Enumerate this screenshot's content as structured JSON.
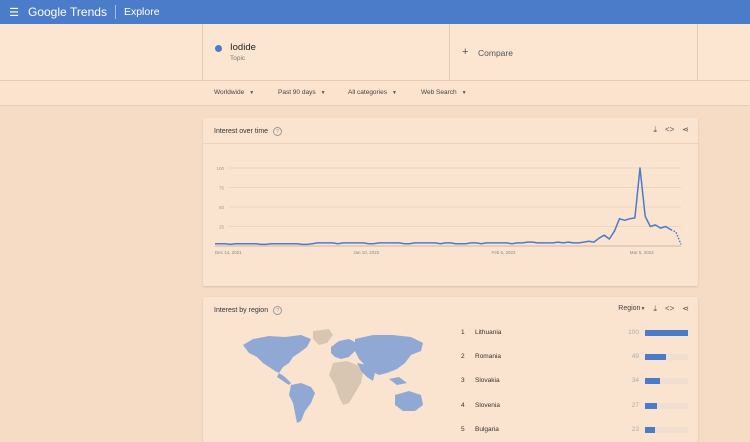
{
  "topbar": {
    "menu_icon": "menu-icon",
    "brand_google": "Google",
    "brand_trends": "Trends",
    "section": "Explore"
  },
  "search": {
    "term": "Iodide",
    "term_type": "Topic",
    "compare_label": "Compare",
    "accent_color": "#4a7cc9"
  },
  "filters": {
    "location": "Worldwide",
    "period": "Past 90 days",
    "category": "All categories",
    "search_type": "Web Search"
  },
  "interest_over_time": {
    "title": "Interest over time",
    "actions": [
      "download-icon",
      "embed-icon",
      "share-icon"
    ]
  },
  "chart_data": {
    "type": "line",
    "title": "",
    "xlabel": "",
    "ylabel": "",
    "ylim": [
      0,
      100
    ],
    "yticks": [
      25,
      50,
      75,
      100
    ],
    "xtick_labels": [
      "Dec 14, 2021",
      "Jan 10, 2022",
      "Feb 6, 2022",
      "Mar 5, 2022"
    ],
    "xtick_index": [
      0,
      27,
      54,
      81
    ],
    "series": [
      {
        "color": "#4a7cc9",
        "values": [
          3,
          3,
          3,
          2,
          3,
          3,
          3,
          3,
          3,
          2,
          2,
          3,
          3,
          3,
          3,
          3,
          3,
          2,
          2,
          3,
          4,
          4,
          4,
          4,
          3,
          4,
          4,
          4,
          4,
          4,
          3,
          3,
          4,
          4,
          4,
          4,
          4,
          3,
          3,
          4,
          4,
          4,
          4,
          4,
          3,
          4,
          4,
          3,
          3,
          3,
          4,
          4,
          3,
          4,
          4,
          4,
          4,
          4,
          3,
          4,
          4,
          5,
          5,
          4,
          4,
          4,
          4,
          5,
          4,
          5,
          4,
          4,
          5,
          6,
          5,
          10,
          14,
          9,
          19,
          35,
          33,
          35,
          36,
          100,
          38,
          25,
          27,
          23,
          25,
          21,
          18,
          2
        ]
      }
    ]
  },
  "interest_by_region": {
    "title": "Interest by region",
    "granularity": "Region",
    "actions": [
      "download-icon",
      "embed-icon",
      "share-icon"
    ],
    "rows": [
      {
        "rank": "1",
        "name": "Lithuania",
        "value": "100",
        "frac": 1.0
      },
      {
        "rank": "2",
        "name": "Romania",
        "value": "49",
        "frac": 0.49
      },
      {
        "rank": "3",
        "name": "Slovakia",
        "value": "34",
        "frac": 0.34
      },
      {
        "rank": "4",
        "name": "Slovenia",
        "value": "27",
        "frac": 0.27
      },
      {
        "rank": "5",
        "name": "Bulgaria",
        "value": "23",
        "frac": 0.23
      }
    ]
  }
}
